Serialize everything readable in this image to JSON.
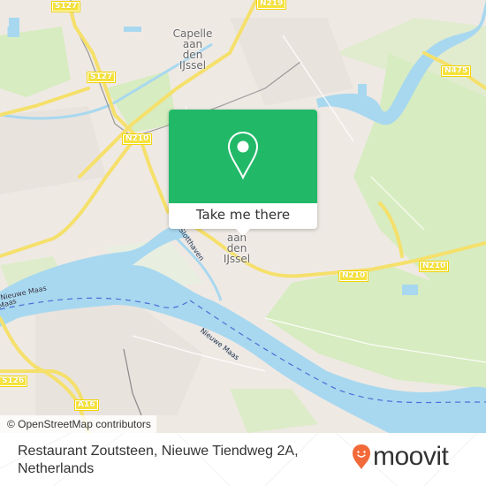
{
  "map": {
    "attribution": "© OpenStreetMap contributors",
    "colors": {
      "land": "#efe9e4",
      "water": "#a8d8ef",
      "park": "#cfe8b4",
      "road_major": "#f6e36a",
      "accent_green": "#21b968",
      "brand_orange": "#f26a3a"
    },
    "road_labels": [
      {
        "id": "s127-top",
        "text": "S127"
      },
      {
        "id": "n219",
        "text": "N219"
      },
      {
        "id": "s127-mid",
        "text": "S127"
      },
      {
        "id": "n475",
        "text": "N475"
      },
      {
        "id": "n210-left",
        "text": "N210"
      },
      {
        "id": "n210-center",
        "text": "N210"
      },
      {
        "id": "n210-right",
        "text": "N210"
      },
      {
        "id": "s126",
        "text": "S126"
      },
      {
        "id": "a16",
        "text": "A16"
      }
    ],
    "place_labels": [
      {
        "id": "capelle-top",
        "lines": [
          "Capelle",
          "aan",
          "den",
          "IJssel"
        ]
      },
      {
        "id": "capelle-center",
        "lines": [
          "aan",
          "den",
          "IJssel"
        ]
      }
    ],
    "water_labels": [
      {
        "id": "nieuwe-maas-left",
        "text": "Nieuwe Maas"
      },
      {
        "id": "maas-left",
        "text": "Maas"
      },
      {
        "id": "nieuwe-maas-right",
        "text": "Nieuwe Maas"
      },
      {
        "id": "sluishaven",
        "text": "Slotthaven"
      }
    ]
  },
  "popup": {
    "icon": "map-pin-icon",
    "cta_label": "Take me there"
  },
  "footer": {
    "address": "Restaurant Zoutsteen, Nieuwe Tiendweg 2A, Netherlands",
    "brand": "moovit",
    "brand_icon": "moovit-pin-logo-icon"
  }
}
